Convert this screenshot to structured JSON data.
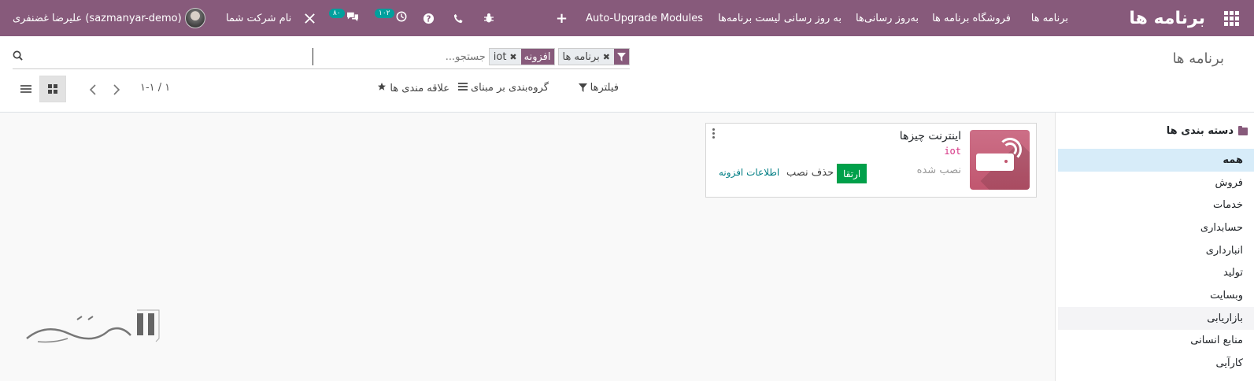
{
  "navbar": {
    "app_title": "برنامه ها",
    "menu": [
      "برنامه ها",
      "فروشگاه برنامه ها",
      "به‌روز رسانی‌ها",
      "به روز رسانی لیست برنامه‌ها",
      "Auto-Upgrade Modules"
    ],
    "add_icon": "+",
    "activity_count": "۱۰۲",
    "messages_count": "۸۰",
    "company": "نام شرکت شما",
    "user": "علیرضا غضنفری (sazmanyar-demo)"
  },
  "control_panel": {
    "breadcrumb": "برنامه ها",
    "search": {
      "facets": [
        {
          "label": "",
          "icon": "filter-icon",
          "value": "برنامه ها"
        },
        {
          "label": "افزونه",
          "icon": "",
          "value": "iot"
        }
      ],
      "placeholder": "جستجو..."
    },
    "filters_label": "فیلترها",
    "groupby_label": "گروه‌بندی بر مبنای",
    "favorites_label": "علاقه مندی ها",
    "pager": "۱-۱ / ۱"
  },
  "sidebar": {
    "header": "دسته بندی ها",
    "items": [
      "همه",
      "فروش",
      "خدمات",
      "حسابداری",
      "انبارداری",
      "تولید",
      "وبسایت",
      "بازاریابی",
      "منابع انسانی",
      "کارآیی"
    ],
    "active_index": 0,
    "hover_index": 7
  },
  "card": {
    "title": "اینترنت چیزها",
    "technical_name": "iot",
    "status": "نصب شده",
    "upgrade_label": "ارتقا",
    "uninstall_label": "حذف نصب",
    "info_label": "اطلاعات افزونه"
  },
  "colors": {
    "primary": "#875a7b",
    "badge": "#00a09d",
    "upgrade": "#00a04a",
    "active_category": "#d7ecf9",
    "link": "#017e84"
  }
}
